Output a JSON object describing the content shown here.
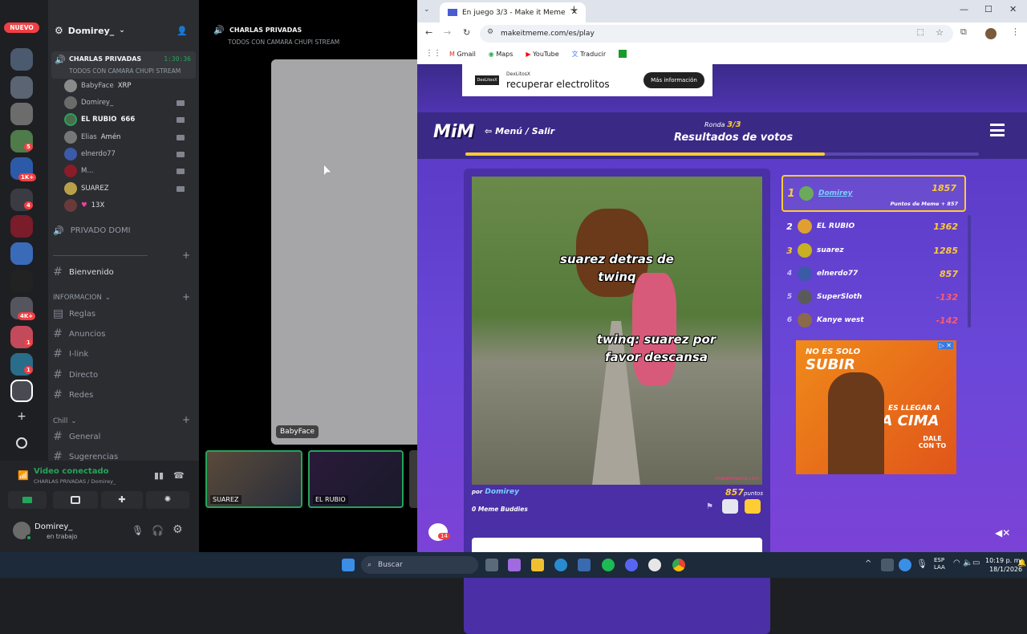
{
  "discord": {
    "new_badge": "NUEVO",
    "server_name": "Domirey_",
    "server_badges": [
      "5",
      "1K+",
      "4",
      "4K+",
      "1",
      "1"
    ],
    "voice_channel": {
      "name": "CHARLAS PRIVADAS",
      "timer": "1:30:36",
      "status": "TODOS CON CAMARA CHUPI STREAM",
      "members": [
        {
          "name": "BabyFace",
          "extra": "XRP"
        },
        {
          "name": "Domirey_",
          "extra": ""
        },
        {
          "name": "EL RUBIO",
          "extra": "666"
        },
        {
          "name": "Elias",
          "extra": "Amén"
        },
        {
          "name": "elnerdo77",
          "extra": ""
        },
        {
          "name": "M...",
          "extra": ""
        },
        {
          "name": "SUAREZ",
          "extra": ""
        },
        {
          "name": "",
          "extra": "13X"
        }
      ]
    },
    "private_channel": "PRIVADO DOMI",
    "channels": [
      {
        "name": "Bienvenido"
      }
    ],
    "categories": [
      {
        "name": "INFORMACION",
        "channels": [
          "Reglas",
          "Anuncios",
          "I-link",
          "Directo",
          "Redes"
        ]
      },
      {
        "name": "Chill",
        "channels": [
          "General",
          "Sugerencias"
        ]
      }
    ],
    "voice_connected": "Video conectado",
    "voice_connected_sub": "CHARLAS PRIVADAS / Domirey_",
    "user": {
      "name": "Domirey_",
      "status": "en trabajo"
    },
    "stage": {
      "title": "CHARLAS PRIVADAS",
      "subtitle": "TODOS CON CAMARA CHUPI STREAM",
      "main_label": "BabyFace",
      "tiles": [
        {
          "label": "SUAREZ"
        },
        {
          "label": "EL RUBIO"
        }
      ]
    }
  },
  "browser": {
    "tab_title": "En juego 3/3 - Make it Meme",
    "url": "makeitmeme.com/es/play",
    "bookmarks": [
      "Gmail",
      "Maps",
      "YouTube",
      "Traducir"
    ],
    "ad_top": {
      "brand": "DexLitosX",
      "text": "recuperar electrolitos",
      "button": "Más información"
    },
    "game": {
      "logo": "MiM",
      "menu": "Menú / Salir",
      "round_label": "Ronda",
      "round": "3/3",
      "results_title": "Resultados de votos",
      "progress": 0.7,
      "meme_top": "suarez detras de twinq",
      "meme_bottom": "twinq: suarez por favor descansa",
      "meme_credit": "makeitmeme.com",
      "by_label": "por",
      "author": "Domirey",
      "points": "857",
      "points_label": "puntos",
      "meme_buddies": "0 Meme Buddies",
      "chat_count": "14",
      "leaderboard": [
        {
          "rank": "1",
          "name": "Domirey",
          "score": "1857",
          "sub": "Puntos de Meme + 857",
          "highlight": true
        },
        {
          "rank": "2",
          "name": "EL RUBIO",
          "score": "1362"
        },
        {
          "rank": "3",
          "name": "suarez",
          "score": "1285"
        },
        {
          "rank": "4",
          "name": "elnerdo77",
          "score": "857"
        },
        {
          "rank": "5",
          "name": "SuperSloth",
          "score": "-132"
        },
        {
          "rank": "6",
          "name": "Kanye west",
          "score": "-142"
        }
      ],
      "ad_side": {
        "line1": "NO ES SOLO",
        "line2": "SUBIR",
        "line3": "ES LLEGAR A",
        "line4": "LA CIMA",
        "line5": "DALE CON TO"
      }
    }
  },
  "taskbar": {
    "search": "Buscar",
    "lang": "ESP",
    "lang2": "LAA",
    "time": "10:19 p. m.",
    "date": "18/1/2026"
  },
  "colors": {
    "accent": "#ffcc33",
    "discord_green": "#23a55a",
    "game_purple": "#6a47d8"
  }
}
